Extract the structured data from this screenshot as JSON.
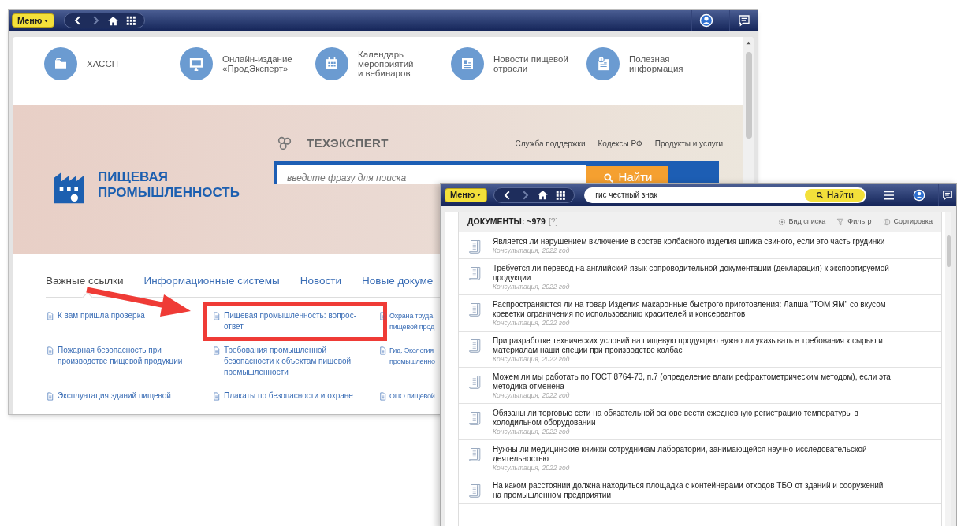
{
  "portal_window": {
    "menu_label": "Меню",
    "nav_items": [
      {
        "label": "ХАССП",
        "kind": "folder"
      },
      {
        "label": "Онлайн-издание\n«ПродЭксперт»",
        "kind": "monitor"
      },
      {
        "label": "Календарь\nмероприятий\nи вебинаров",
        "kind": "calendar"
      },
      {
        "label": "Новости пищевой\nотрасли",
        "kind": "news"
      },
      {
        "label": "Полезная\nинформация",
        "kind": "info"
      }
    ],
    "brand": "ПИЩЕВАЯ\nПРОМЫШЛЕННОСТЬ",
    "vendor_logo": "ТЕХЭКСПЕRТ",
    "header_links": [
      "Служба поддержки",
      "Кодексы РФ",
      "Продукты и услуги"
    ],
    "search": {
      "placeholder": "введите фразу для поиска",
      "button": "Найти"
    },
    "tabs": [
      {
        "label": "Важные ссылки",
        "selected": true
      },
      {
        "label": "Информационные системы",
        "selected": false
      },
      {
        "label": "Новости",
        "selected": false
      },
      {
        "label": "Новые докуме",
        "selected": false
      }
    ],
    "links": [
      {
        "text": "К вам пришла проверка",
        "highlighted": false
      },
      {
        "text": "Пищевая промышленность: вопрос-ответ",
        "highlighted": true
      },
      {
        "text": "Охрана труда\nпищевой прод",
        "highlighted": false
      },
      {
        "text": "Пожарная безопасность при производстве пищевой продукции",
        "highlighted": false
      },
      {
        "text": "Требования промышленной безопасности к объектам пищевой промышленности",
        "highlighted": false
      },
      {
        "text": "Гид. Экология\nпромышленно",
        "highlighted": false
      },
      {
        "text": "Эксплуатация зданий пищевой",
        "highlighted": false
      },
      {
        "text": "Плакаты по безопасности и охране",
        "highlighted": false
      },
      {
        "text": "ОПО пищевой",
        "highlighted": false
      }
    ]
  },
  "results_window": {
    "menu_label": "Меню",
    "search_value": "гис честный знак",
    "search_button": "Найти",
    "title": "ДОКУМЕНТЫ: ~979",
    "help": "[?]",
    "actions": [
      {
        "label": "Вид списка",
        "kind": "gear"
      },
      {
        "label": "Фильтр",
        "kind": "filter"
      },
      {
        "label": "Сортировка",
        "kind": "sort"
      }
    ],
    "rows": [
      {
        "title": "Является ли нарушением включение в состав колбасного изделия шпика свиного, если это часть грудинки",
        "meta": "Консультация, 2022 год"
      },
      {
        "title": "Требуется ли перевод на английский язык сопроводительной документации (декларация) к экспортируемой продукции",
        "meta": "Консультация, 2022 год"
      },
      {
        "title": "Распространяются ли на товар Изделия макаронные быстрого приготовления: Лапша \"ТОМ ЯМ\" со вкусом креветки ограничения по использованию красителей и консервантов",
        "meta": "Консультация, 2022 год"
      },
      {
        "title": "При разработке технических условий на пищевую продукцию нужно ли указывать в требования к сырью и материалам наши специи при производстве колбас",
        "meta": "Консультация, 2022 год"
      },
      {
        "title": "Можем ли мы работать по ГОСТ 8764-73, п.7 (определение влаги рефрактометрическим методом), если эта методика отменена",
        "meta": "Консультация, 2022 год"
      },
      {
        "title": "Обязаны ли торговые сети на обязательной основе вести ежедневную регистрацию температуры в холодильном оборудовании",
        "meta": "Консультация, 2022 год"
      },
      {
        "title": "Нужны ли медицинские книжки сотрудникам лаборатории, занимающейся научно-исследовательской деятельностью",
        "meta": "Консультация, 2022 год"
      },
      {
        "title": "На каком расстоянии должна находиться площадка с контейнерами отходов ТБО от зданий и сооружений на промышленном предприятии"
      }
    ]
  }
}
